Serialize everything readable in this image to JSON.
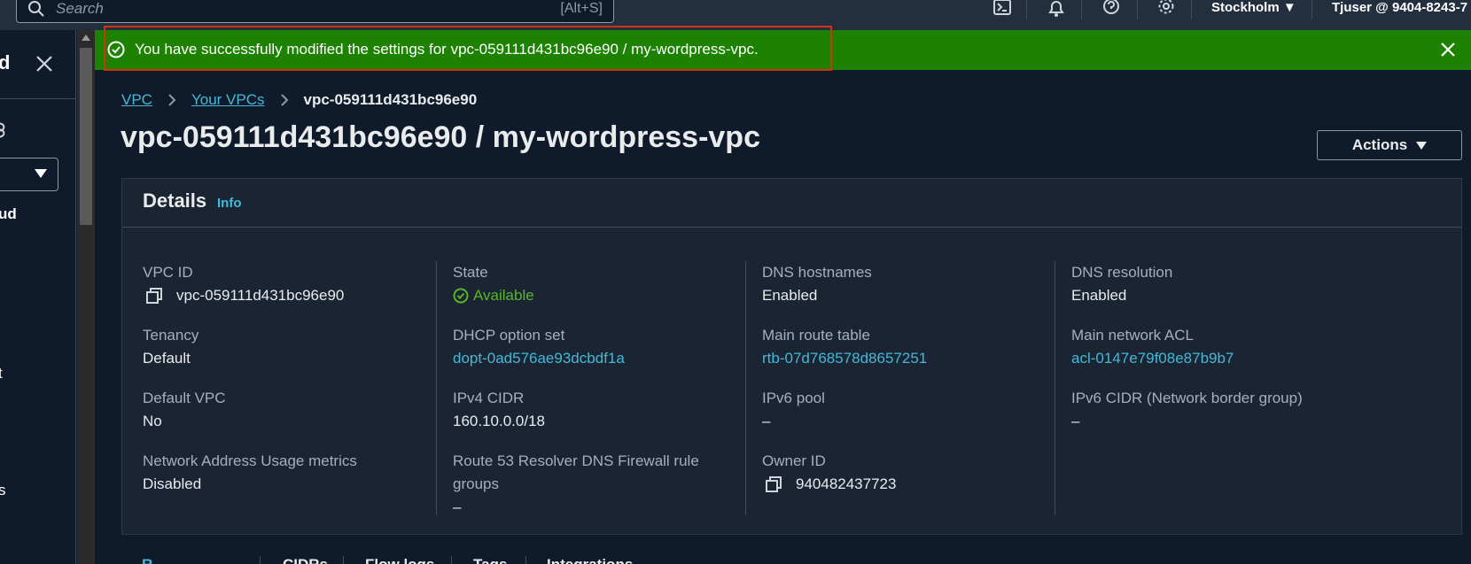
{
  "topnav": {
    "search_placeholder": "Search",
    "search_shortcut": "[Alt+S]",
    "region": "Stockholm",
    "account": "Tjuser @ 9404-8243-7"
  },
  "sidebar": {
    "frag_1": "d",
    "frag_2": "ud",
    "frag_3": "t",
    "frag_4": "s"
  },
  "flash": {
    "message": "You have successfully modified the settings for vpc-059111d431bc96e90 / my-wordpress-vpc."
  },
  "breadcrumb": {
    "item_1": "VPC",
    "item_2": "Your VPCs",
    "current": "vpc-059111d431bc96e90"
  },
  "page": {
    "title": "vpc-059111d431bc96e90 / my-wordpress-vpc",
    "actions_label": "Actions"
  },
  "details": {
    "heading": "Details",
    "info_label": "Info",
    "vpc_id": {
      "label": "VPC ID",
      "value": "vpc-059111d431bc96e90"
    },
    "tenancy": {
      "label": "Tenancy",
      "value": "Default"
    },
    "default_vpc": {
      "label": "Default VPC",
      "value": "No"
    },
    "nau_metrics": {
      "label": "Network Address Usage metrics",
      "value": "Disabled"
    },
    "state": {
      "label": "State",
      "value": "Available"
    },
    "dhcp": {
      "label": "DHCP option set",
      "value": "dopt-0ad576ae93dcbdf1a"
    },
    "ipv4_cidr": {
      "label": "IPv4 CIDR",
      "value": "160.10.0.0/18"
    },
    "r53_firewall": {
      "label_1": "Route 53 Resolver DNS Firewall rule",
      "label_2": "groups",
      "value": "–"
    },
    "dns_hostnames": {
      "label": "DNS hostnames",
      "value": "Enabled"
    },
    "main_route_table": {
      "label": "Main route table",
      "value": "rtb-07d768578d8657251"
    },
    "ipv6_pool": {
      "label": "IPv6 pool",
      "value": "–"
    },
    "owner_id": {
      "label": "Owner ID",
      "value": "940482437723"
    },
    "dns_resolution": {
      "label": "DNS resolution",
      "value": "Enabled"
    },
    "main_acl": {
      "label": "Main network ACL",
      "value": "acl-0147e79f08e87b9b7"
    },
    "ipv6_cidr": {
      "label": "IPv6 CIDR (Network border group)",
      "value": "–"
    }
  },
  "tabs_peek": [
    "R",
    "CIDRs",
    "Flow logs",
    "Tags",
    "Integrations"
  ],
  "colors": {
    "success": "#1d8102",
    "link": "#44b9d6",
    "available": "#5ab527",
    "focus_outline": "#d13212"
  }
}
